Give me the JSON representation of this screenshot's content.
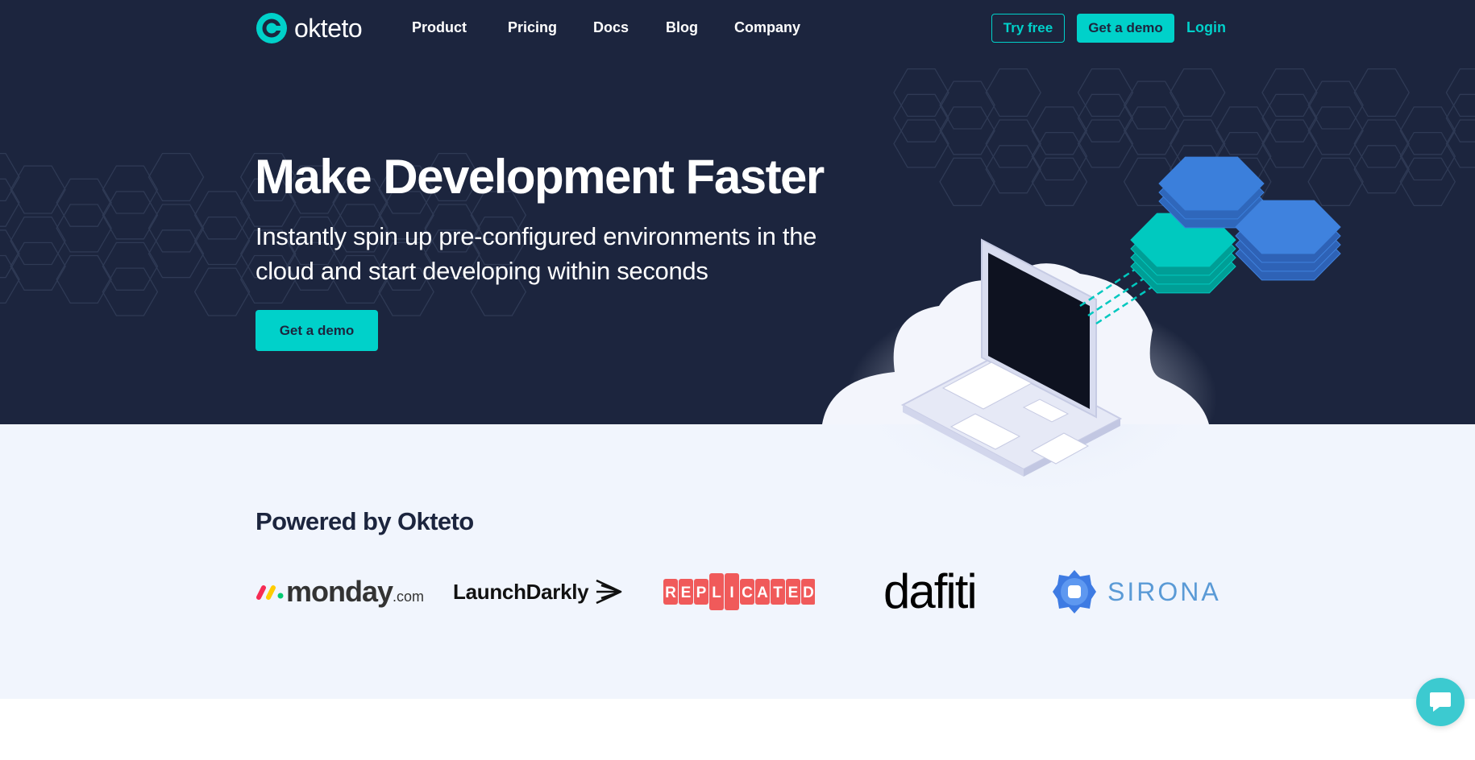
{
  "brand": {
    "name": "okteto",
    "accent": "#00d1ca",
    "dark": "#1c253e",
    "light_bg": "#f1f5fd"
  },
  "nav": {
    "links": [
      "Product",
      "Pricing",
      "Docs",
      "Blog",
      "Company"
    ],
    "try_free": "Try free",
    "get_demo": "Get a demo",
    "login": "Login"
  },
  "hero": {
    "title": "Make Development Faster",
    "subtitle": "Instantly spin up pre-configured environments in the cloud and start developing within seconds",
    "cta": "Get a demo"
  },
  "powered": {
    "heading": "Powered by Okteto",
    "logos": {
      "monday_main": "monday",
      "monday_suffix": ".com",
      "launchdarkly": "LaunchDarkly",
      "replicated": "REPLICATED",
      "dafiti": "dafiti",
      "sirona": "SIRONA"
    }
  },
  "chat": {
    "icon": "chat-bubble-icon"
  }
}
